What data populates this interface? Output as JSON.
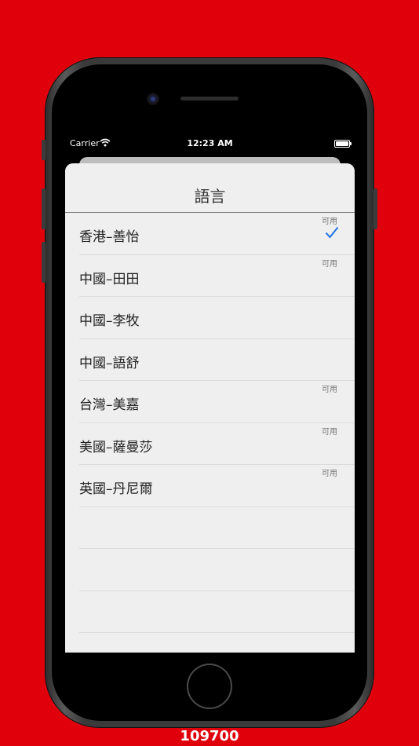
{
  "status_bar": {
    "carrier": "Carrier",
    "time": "12:23 AM"
  },
  "sheet": {
    "title": "語言"
  },
  "languages": [
    {
      "label": "香港–善怡",
      "tag": "可用",
      "selected": true
    },
    {
      "label": "中國–田田",
      "tag": "可用",
      "selected": false
    },
    {
      "label": "中國–李牧",
      "tag": "",
      "selected": false
    },
    {
      "label": "中國–語舒",
      "tag": "",
      "selected": false
    },
    {
      "label": "台灣–美嘉",
      "tag": "可用",
      "selected": false
    },
    {
      "label": "美國–薩曼莎",
      "tag": "可用",
      "selected": false
    },
    {
      "label": "英國–丹尼爾",
      "tag": "可用",
      "selected": false
    }
  ],
  "footer": {
    "number": "109700"
  },
  "colors": {
    "background": "#e0000b",
    "checkmark": "#1a73e8"
  }
}
